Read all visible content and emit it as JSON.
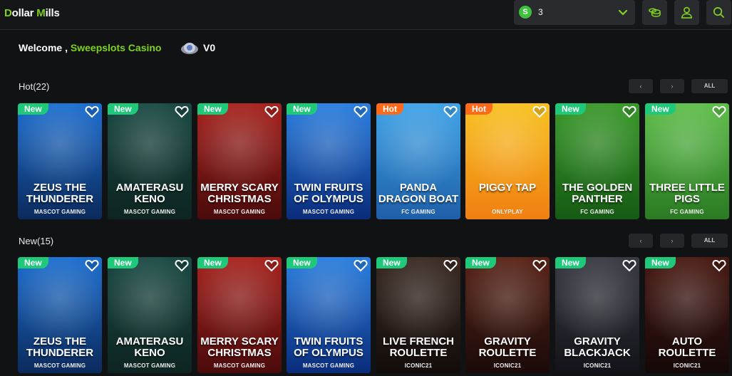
{
  "header": {
    "logo_d": "D",
    "logo_middle": "ollar ",
    "logo_m": "M",
    "logo_end": "ills",
    "coin_symbol": "S",
    "coin_value": "3"
  },
  "welcome": {
    "prefix": "Welcome , ",
    "name": "Sweepslots Casino",
    "level": "V0"
  },
  "sections": [
    {
      "title": "Hot(22)",
      "all_label": "ALL",
      "prev_label": "‹",
      "next_label": "›",
      "games": [
        {
          "badge": "New",
          "title": "ZEUS THE THUNDERER",
          "provider": "MASCOT GAMING",
          "colors": [
            "#1c6fd1",
            "#0b2a5c"
          ]
        },
        {
          "badge": "New",
          "title": "AMATERASU KENO",
          "provider": "MASCOT GAMING",
          "colors": [
            "#1a4a44",
            "#0d2421"
          ]
        },
        {
          "badge": "New",
          "title": "MERRY SCARY CHRISTMAS",
          "provider": "MASCOT GAMING",
          "colors": [
            "#a8231e",
            "#4a0b0b"
          ]
        },
        {
          "badge": "New",
          "title": "TWIN FRUITS OF OLYMPUS",
          "provider": "MASCOT GAMING",
          "colors": [
            "#2a7fe0",
            "#0a2c7a"
          ]
        },
        {
          "badge": "Hot",
          "title": "PANDA DRAGON BOAT",
          "provider": "FC GAMING",
          "colors": [
            "#3fa4e8",
            "#1e5fa8"
          ]
        },
        {
          "badge": "Hot",
          "title": "PIGGY TAP",
          "provider": "ONLYPLAY",
          "colors": [
            "#f7c21f",
            "#f07f12"
          ]
        },
        {
          "badge": "New",
          "title": "THE GOLDEN PANTHER",
          "provider": "FC GAMING",
          "colors": [
            "#3a9a2a",
            "#165a14"
          ]
        },
        {
          "badge": "New",
          "title": "THREE LITTLE PIGS",
          "provider": "FC GAMING",
          "colors": [
            "#5fbf4a",
            "#2a7a22"
          ]
        }
      ]
    },
    {
      "title": "New(15)",
      "all_label": "ALL",
      "prev_label": "‹",
      "next_label": "›",
      "games": [
        {
          "badge": "New",
          "title": "ZEUS THE THUNDERER",
          "provider": "MASCOT GAMING",
          "colors": [
            "#1c6fd1",
            "#0b2a5c"
          ]
        },
        {
          "badge": "New",
          "title": "AMATERASU KENO",
          "provider": "MASCOT GAMING",
          "colors": [
            "#1a4a44",
            "#0d2421"
          ]
        },
        {
          "badge": "New",
          "title": "MERRY SCARY CHRISTMAS",
          "provider": "MASCOT GAMING",
          "colors": [
            "#a8231e",
            "#4a0b0b"
          ]
        },
        {
          "badge": "New",
          "title": "TWIN FRUITS OF OLYMPUS",
          "provider": "MASCOT GAMING",
          "colors": [
            "#2a7fe0",
            "#0a2c7a"
          ]
        },
        {
          "badge": "New",
          "title": "LIVE FRENCH ROULETTE",
          "provider": "ICONIC21",
          "colors": [
            "#3a2a22",
            "#120c0a"
          ]
        },
        {
          "badge": "New",
          "title": "GRAVITY ROULETTE",
          "provider": "ICONIC21",
          "colors": [
            "#5a2418",
            "#1a0a08"
          ]
        },
        {
          "badge": "New",
          "title": "GRAVITY BLACKJACK",
          "provider": "ICONIC21",
          "colors": [
            "#3a3a44",
            "#121218"
          ]
        },
        {
          "badge": "New",
          "title": "AUTO ROULETTE",
          "provider": "ICONIC21",
          "colors": [
            "#4a1a14",
            "#140808"
          ]
        }
      ]
    }
  ]
}
